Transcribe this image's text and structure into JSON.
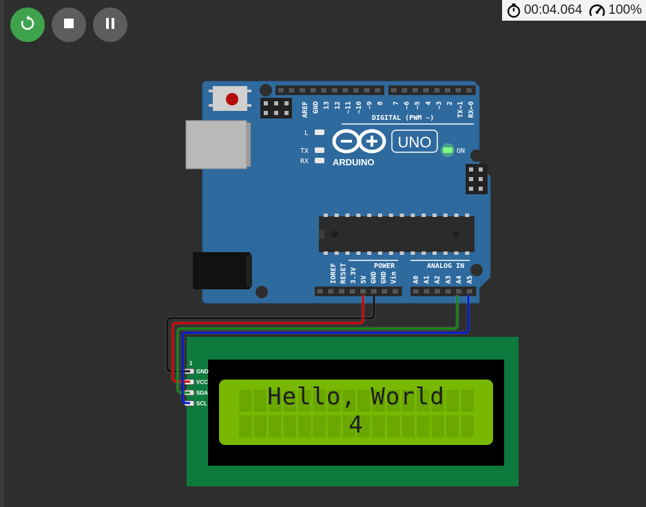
{
  "controls": {
    "restart_icon": "restart-icon",
    "stop_icon": "stop-icon",
    "pause_icon": "pause-icon"
  },
  "status": {
    "timer": "00:04.064",
    "speed": "100%"
  },
  "arduino": {
    "brand": "ARDUINO",
    "model": "UNO",
    "on_label": "ON",
    "led_l": "L",
    "led_tx": "TX",
    "led_rx": "RX",
    "digital_header": "DIGITAL (PWM ~)",
    "power_header": "POWER",
    "analog_header": "ANALOG IN",
    "digital_pins": [
      "AREF",
      "GND",
      "13",
      "12",
      "~11",
      "~10",
      "~9",
      "8",
      "7",
      "~6",
      "~5",
      "4",
      "~3",
      "2",
      "TX→1",
      "RX←0"
    ],
    "power_pins": [
      "IOREF",
      "RESET",
      "3.3V",
      "5V",
      "GND",
      "GND",
      "Vin"
    ],
    "analog_pins": [
      "A0",
      "A1",
      "A2",
      "A3",
      "A4",
      "A5"
    ],
    "colors": {
      "board": "#2f6a9e",
      "led_on": "#7dff7d"
    }
  },
  "lcd": {
    "pin_marker": "1",
    "pins": [
      "GND",
      "VCC",
      "SDA",
      "SCL"
    ],
    "line1": "Hello, World",
    "line2": "4",
    "colors": {
      "pcb": "#0e7a3e",
      "screen": "#78b800"
    }
  },
  "wires": {
    "colors": {
      "gnd": "#111111",
      "vcc": "#d00000",
      "sda": "#128a12",
      "scl": "#0018d0"
    }
  }
}
